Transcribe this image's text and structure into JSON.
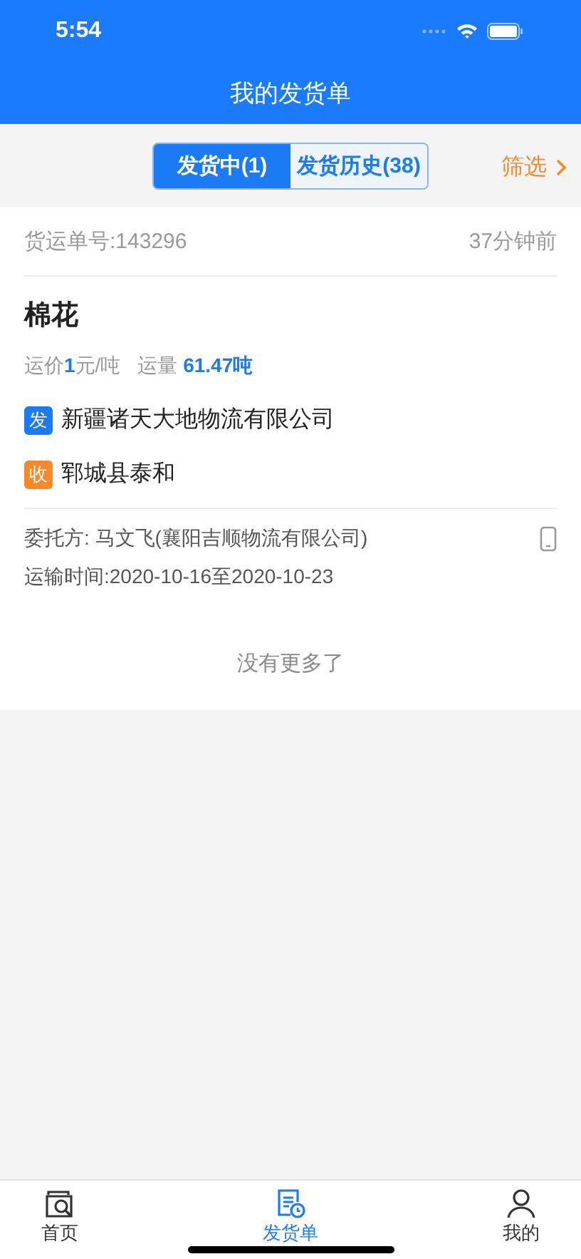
{
  "status_bar": {
    "time": "5:54"
  },
  "title": "我的发货单",
  "tabs": [
    {
      "label": "发货中(1)",
      "selected": true
    },
    {
      "label": "发货历史(38)",
      "selected": false
    }
  ],
  "filter": {
    "label": "筛选"
  },
  "orders": [
    {
      "number_label": "货运单号:143296",
      "time_ago": "37分钟前",
      "cargo": "棉花",
      "price_label": "运价",
      "price_value": "1",
      "price_unit": "元/吨",
      "volume_label": "运量",
      "volume_value": "61.47吨",
      "stops": [
        {
          "kind": "origin",
          "tag": "发",
          "place": "新疆诸天大地物流有限公司"
        },
        {
          "kind": "destination",
          "tag": "收",
          "place": "郓城县泰和"
        }
      ],
      "shipper": "委托方: 马文飞(襄阳吉顺物流有限公司)",
      "period": "运输时间:2020-10-16至2020-10-23"
    }
  ],
  "end_note": "没有更多了",
  "bottom_tabs": [
    {
      "kind": "home",
      "label": "首页",
      "selected": false
    },
    {
      "kind": "orders",
      "label": "发货单",
      "selected": true
    },
    {
      "kind": "profile",
      "label": "我的",
      "selected": false
    }
  ]
}
